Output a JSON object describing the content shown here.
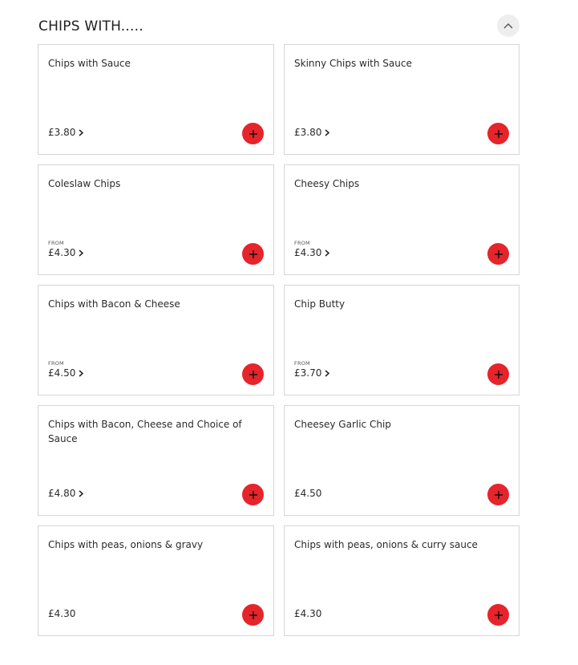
{
  "section": {
    "title": "CHIPS WITH.....",
    "collapse_icon": "chevron-up-icon"
  },
  "colors": {
    "accent": "#e6242b",
    "card_border": "#d6d6d6",
    "collapse_bg": "#eeeeee"
  },
  "items": [
    {
      "name": "Chips with Sauce",
      "from": "",
      "price": "£3.80",
      "has_options": true
    },
    {
      "name": "Skinny Chips with Sauce",
      "from": "",
      "price": "£3.80",
      "has_options": true
    },
    {
      "name": "Coleslaw Chips",
      "from": "FROM",
      "price": "£4.30",
      "has_options": true
    },
    {
      "name": "Cheesy Chips",
      "from": "FROM",
      "price": "£4.30",
      "has_options": true
    },
    {
      "name": "Chips with Bacon & Cheese",
      "from": "FROM",
      "price": "£4.50",
      "has_options": true
    },
    {
      "name": "Chip Butty",
      "from": "FROM",
      "price": "£3.70",
      "has_options": true
    },
    {
      "name": "Chips with Bacon, Cheese and Choice of Sauce",
      "from": "",
      "price": "£4.80",
      "has_options": true
    },
    {
      "name": "Cheesey Garlic Chip",
      "from": "",
      "price": "£4.50",
      "has_options": false
    },
    {
      "name": "Chips with peas, onions & gravy",
      "from": "",
      "price": "£4.30",
      "has_options": false
    },
    {
      "name": "Chips with peas, onions & curry sauce",
      "from": "",
      "price": "£4.30",
      "has_options": false
    }
  ]
}
